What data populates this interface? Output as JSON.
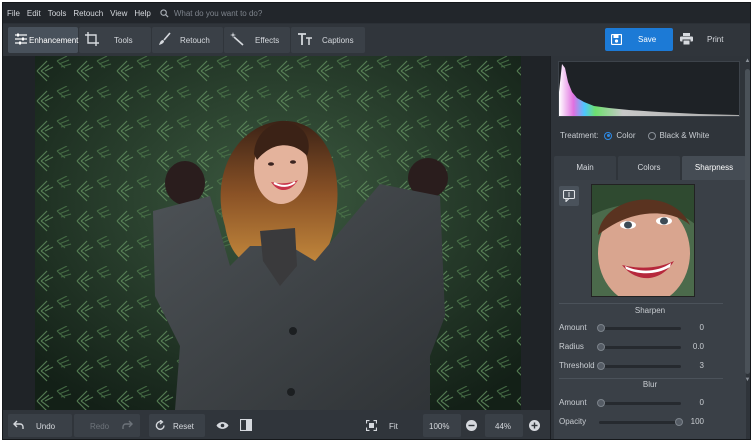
{
  "menu": {
    "items": [
      "File",
      "Edit",
      "Tools",
      "Retouch",
      "View",
      "Help"
    ],
    "search_placeholder": "What do you want to do?"
  },
  "toolbar": {
    "tabs": [
      {
        "label": "Enhancement",
        "icon": "sliders-icon",
        "active": true
      },
      {
        "label": "Tools",
        "icon": "crop-icon",
        "active": false
      },
      {
        "label": "Retouch",
        "icon": "brush-icon",
        "active": false
      },
      {
        "label": "Effects",
        "icon": "magic-wand-icon",
        "active": false
      },
      {
        "label": "Captions",
        "icon": "text-icon",
        "active": false
      }
    ],
    "save_label": "Save",
    "print_label": "Print",
    "accent_color": "#1c7ad6"
  },
  "bottombar": {
    "undo_label": "Undo",
    "redo_label": "Redo",
    "reset_label": "Reset",
    "fit_label": "Fit",
    "zoom_100": "100%",
    "zoom_level": "44%"
  },
  "panel": {
    "treatment_label": "Treatment:",
    "treatment_options": [
      "Color",
      "Black & White"
    ],
    "treatment_selected": "Color",
    "tabs": [
      "Main",
      "Colors",
      "Sharpness"
    ],
    "active_tab": "Sharpness",
    "sharpen": {
      "title": "Sharpen",
      "sliders": [
        {
          "label": "Amount",
          "value": "0",
          "fraction": 0.0
        },
        {
          "label": "Radius",
          "value": "0.0",
          "fraction": 0.0
        },
        {
          "label": "Threshold",
          "value": "3",
          "fraction": 0.0
        }
      ]
    },
    "blur": {
      "title": "Blur",
      "sliders": [
        {
          "label": "Amount",
          "value": "0",
          "fraction": 0.0
        },
        {
          "label": "Opacity",
          "value": "100",
          "fraction": 1.0
        }
      ]
    }
  }
}
